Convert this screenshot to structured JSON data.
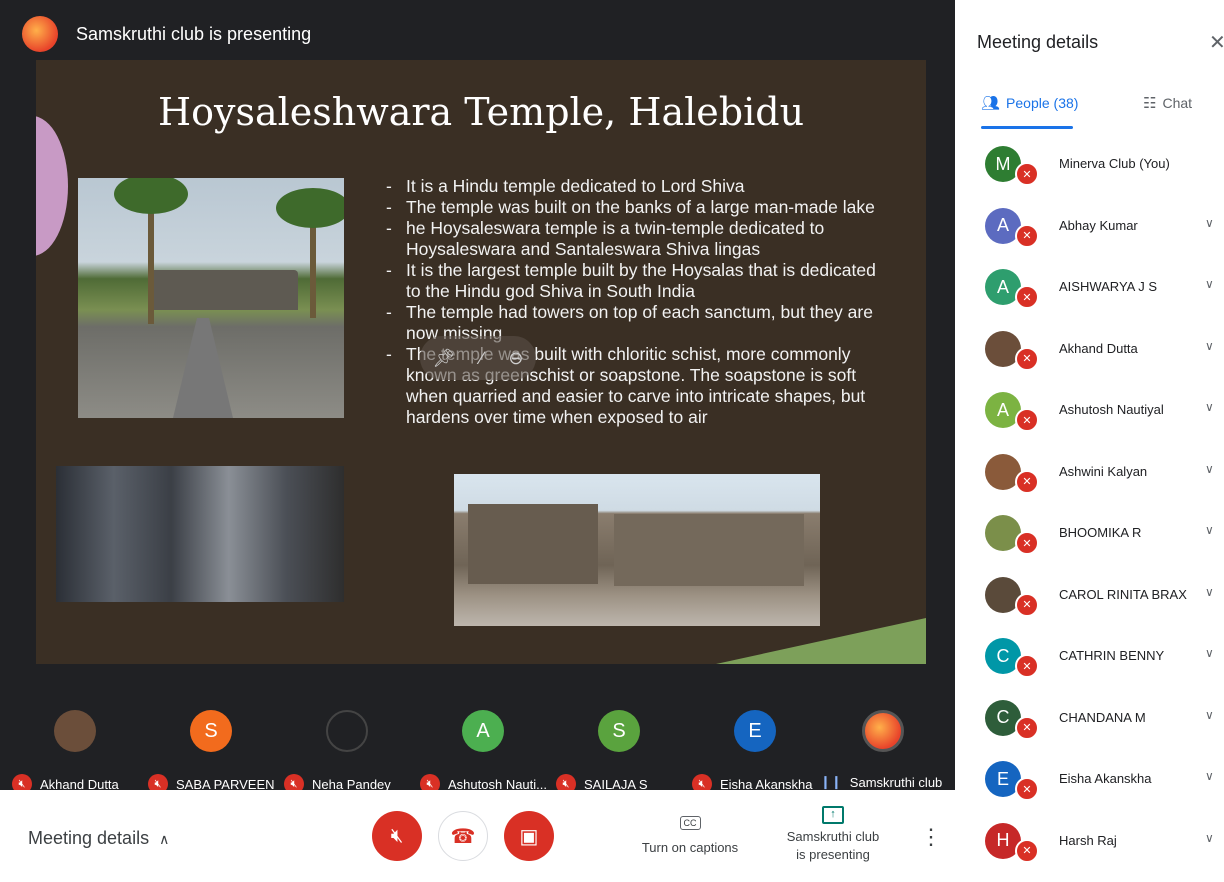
{
  "presenting": {
    "label": "Samskruthi club is presenting"
  },
  "slide": {
    "title": "Hoysaleshwara Temple, Halebidu",
    "bullets": [
      "It is a Hindu temple dedicated to Lord Shiva",
      "The temple was built on the banks of a large man-made lake",
      "he Hoysaleswara temple is a twin-temple dedicated to Hoysaleswara and Santaleswara Shiva lingas",
      "It is the largest temple built by the Hoysalas that is dedicated to the Hindu god Shiva in South India",
      "The temple had towers on top of each sanctum, but they are now missing",
      "The temple was built with chloritic schist, more commonly known as greenschist or soapstone. The soapstone is soft when quarried and easier to carve into intricate shapes, but hardens over time when exposed to air"
    ]
  },
  "tiles": [
    {
      "name": "Akhand Dutta",
      "initial": "",
      "color": "#6b4e3a",
      "muted": true
    },
    {
      "name": "SABA PARVEEN",
      "initial": "S",
      "color": "#f26b1d",
      "muted": true
    },
    {
      "name": "Neha Pandey",
      "initial": "",
      "color": "#202124",
      "muted": true
    },
    {
      "name": "Ashutosh Nauti...",
      "initial": "A",
      "color": "#4caf50",
      "muted": true
    },
    {
      "name": "SAILAJA S",
      "initial": "S",
      "color": "#5aa33e",
      "muted": true
    },
    {
      "name": "Eisha Akanskha",
      "initial": "E",
      "color": "#1565c0",
      "muted": true
    },
    {
      "name": "Samskruthi club",
      "initial": "",
      "color": "#e8432a",
      "muted": false
    }
  ],
  "bottom": {
    "meeting_details": "Meeting details",
    "captions": "Turn on captions",
    "cc": "CC",
    "present_line1": "Samskruthi club",
    "present_line2": "is presenting"
  },
  "panel": {
    "title": "Meeting details",
    "tab_people": "People (38)",
    "tab_chat": "Chat",
    "people": [
      {
        "name": "Minerva Club (You)",
        "initial": "M",
        "color": "#2e7d32",
        "chev": false
      },
      {
        "name": "Abhay Kumar",
        "initial": "A",
        "color": "#5c6bc0",
        "chev": true
      },
      {
        "name": "AISHWARYA J S",
        "initial": "A",
        "color": "#2e9e6e",
        "chev": true
      },
      {
        "name": "Akhand Dutta",
        "initial": "",
        "color": "#6b4e3a",
        "chev": true
      },
      {
        "name": "Ashutosh Nautiyal",
        "initial": "A",
        "color": "#7cb342",
        "chev": true
      },
      {
        "name": "Ashwini Kalyan",
        "initial": "",
        "color": "#8a5a3a",
        "chev": true
      },
      {
        "name": "BHOOMIKA R",
        "initial": "",
        "color": "#7b8f4a",
        "chev": true
      },
      {
        "name": "CAROL RINITA BRAX",
        "initial": "",
        "color": "#5a4a3a",
        "chev": true
      },
      {
        "name": "CATHRIN BENNY",
        "initial": "C",
        "color": "#0097a7",
        "chev": true
      },
      {
        "name": "CHANDANA M",
        "initial": "C",
        "color": "#2e5d3a",
        "chev": true
      },
      {
        "name": "Eisha Akanskha",
        "initial": "E",
        "color": "#1565c0",
        "chev": true
      },
      {
        "name": "Harsh Raj",
        "initial": "H",
        "color": "#c62828",
        "chev": true
      }
    ]
  }
}
